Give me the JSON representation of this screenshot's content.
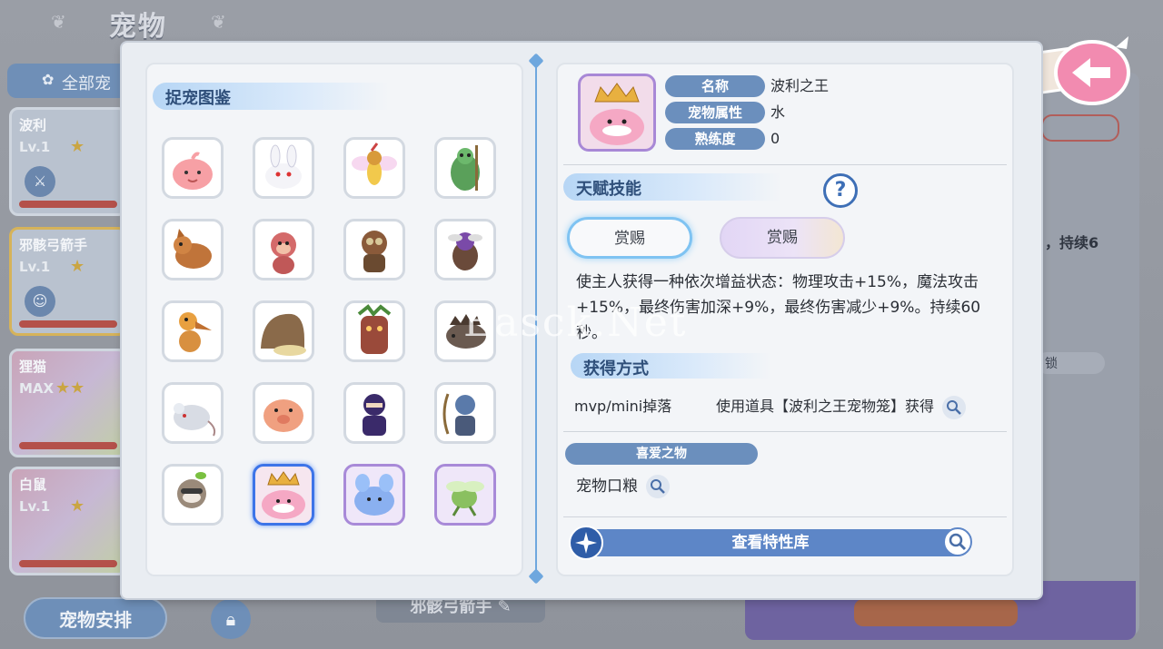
{
  "background": {
    "title": "宠物",
    "tab_all": "全部宠",
    "pet_list": [
      {
        "name": "波利",
        "level": "Lv.1",
        "stars": "★"
      },
      {
        "name": "邪骸弓箭手",
        "level": "Lv.1",
        "stars": "★"
      },
      {
        "name": "狸猫",
        "level": "MAX",
        "stars": "★★"
      },
      {
        "name": "白鼠",
        "level": "Lv.1",
        "stars": "★"
      }
    ],
    "arrange_button": "宠物安排",
    "current_pet_name": "邪骸弓箭手",
    "right_text": "，持续6",
    "right_tag": "锁"
  },
  "catalog": {
    "title": "捉宠图鉴",
    "pets": [
      {
        "icon": "poring-icon"
      },
      {
        "icon": "lunatic-icon"
      },
      {
        "icon": "creamy-icon"
      },
      {
        "icon": "rocker-icon"
      },
      {
        "icon": "wolf-icon"
      },
      {
        "icon": "yoyo-icon"
      },
      {
        "icon": "orc-warrior-icon"
      },
      {
        "icon": "chonchon-icon"
      },
      {
        "icon": "peco-bird-icon"
      },
      {
        "icon": "snail-icon"
      },
      {
        "icon": "tree-monster-icon"
      },
      {
        "icon": "boar-icon"
      },
      {
        "icon": "rat-icon"
      },
      {
        "icon": "pig-icon"
      },
      {
        "icon": "ninja-icon"
      },
      {
        "icon": "archer-skeleton-icon"
      },
      {
        "icon": "raccoon-icon"
      },
      {
        "icon": "poring-king-icon"
      },
      {
        "icon": "blue-bunny-icon"
      },
      {
        "icon": "green-insect-icon"
      }
    ]
  },
  "detail": {
    "name_label": "名称",
    "name_value": "波利之王",
    "attr_label": "宠物属性",
    "attr_value": "水",
    "prof_label": "熟练度",
    "prof_value": "0",
    "talent_title": "天赋技能",
    "help_symbol": "?",
    "skill_btn_1": "赏赐",
    "skill_btn_2": "赏赐",
    "skill_desc": "使主人获得一种依次增益状态：物理攻击+15%，魔法攻击+15%，最终伤害加深+9%，最终伤害减少+9%。持续60秒。",
    "obtain_title": "获得方式",
    "obtain_source_1": "mvp/mini掉落",
    "obtain_source_2": "使用道具【波利之王宠物笼】获得",
    "favorite_title": "喜爱之物",
    "favorite_item": "宠物口粮",
    "trait_button": "查看特性库"
  },
  "watermark": "Easck.Net",
  "colors": {
    "accent_blue": "#6b8fbd",
    "selected_border": "#3d74e8",
    "divider": "#6ea7de"
  }
}
